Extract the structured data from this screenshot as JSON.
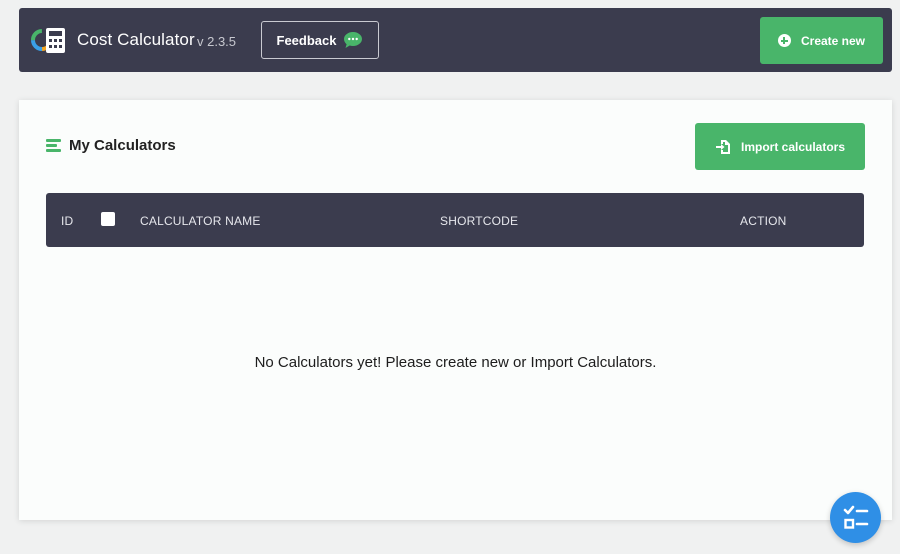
{
  "header": {
    "app_title": "Cost Calculator",
    "version": "v 2.3.5",
    "feedback_label": "Feedback",
    "create_label": "Create new"
  },
  "section": {
    "title": "My Calculators",
    "import_label": "Import calculators"
  },
  "table": {
    "columns": [
      "ID",
      "CALCULATOR NAME",
      "SHORTCODE",
      "ACTION"
    ],
    "rows": []
  },
  "empty_message": "No Calculators yet! Please create new or Import Calculators.",
  "colors": {
    "header_bg": "#3b3c4e",
    "accent_green": "#49b56a",
    "fab_blue": "#2f8fe6"
  },
  "icons": {
    "logo": "calculator-logo-icon",
    "feedback": "chat-bubble-icon",
    "create": "plus-circle-icon",
    "section": "menu-lines-icon",
    "import": "file-import-icon",
    "fab": "checklist-icon"
  }
}
